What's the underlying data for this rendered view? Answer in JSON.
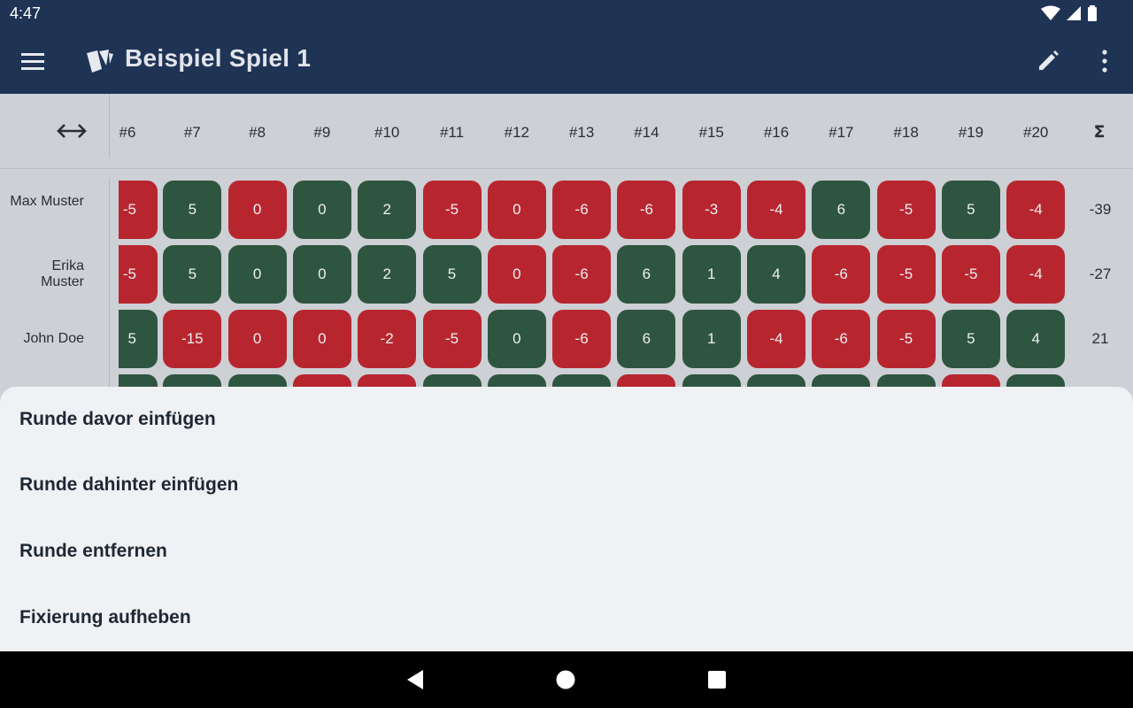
{
  "status_bar": {
    "time": "4:47"
  },
  "app_bar": {
    "title": "Beispiel Spiel 1"
  },
  "table": {
    "rounds": [
      "#6",
      "#7",
      "#8",
      "#9",
      "#10",
      "#11",
      "#12",
      "#13",
      "#14",
      "#15",
      "#16",
      "#17",
      "#18",
      "#19",
      "#20"
    ],
    "sum_label": "Σ",
    "players": [
      {
        "name": "Max Muster",
        "scores": [
          "-5",
          "5",
          "0",
          "0",
          "2",
          "-5",
          "0",
          "-6",
          "-6",
          "-3",
          "-4",
          "6",
          "-5",
          "5",
          "-4"
        ],
        "colors": [
          "red",
          "green",
          "red",
          "green",
          "green",
          "red",
          "red",
          "red",
          "red",
          "red",
          "red",
          "green",
          "red",
          "green",
          "red"
        ],
        "total": "-39"
      },
      {
        "name": "Erika Muster",
        "scores": [
          "-5",
          "5",
          "0",
          "0",
          "2",
          "5",
          "0",
          "-6",
          "6",
          "1",
          "4",
          "-6",
          "-5",
          "-5",
          "-4"
        ],
        "colors": [
          "red",
          "green",
          "green",
          "green",
          "green",
          "green",
          "red",
          "red",
          "green",
          "green",
          "green",
          "red",
          "red",
          "red",
          "red"
        ],
        "total": "-27"
      },
      {
        "name": "John Doe",
        "scores": [
          "5",
          "-15",
          "0",
          "0",
          "-2",
          "-5",
          "0",
          "-6",
          "6",
          "1",
          "-4",
          "-6",
          "-5",
          "5",
          "4"
        ],
        "colors": [
          "green",
          "red",
          "red",
          "red",
          "red",
          "red",
          "green",
          "red",
          "green",
          "green",
          "red",
          "red",
          "red",
          "green",
          "green"
        ],
        "total": "21"
      },
      {
        "name": "",
        "scores": [
          "",
          "",
          "",
          "",
          "",
          "",
          "",
          "",
          "",
          "",
          "",
          "",
          "",
          "",
          ""
        ],
        "colors": [
          "green",
          "green",
          "green",
          "red",
          "red",
          "green",
          "green",
          "green",
          "red",
          "green",
          "green",
          "green",
          "green",
          "red",
          "green"
        ],
        "total": ""
      }
    ]
  },
  "bottom_sheet": {
    "items": [
      {
        "label": "Runde davor einfügen"
      },
      {
        "label": "Runde dahinter einfügen"
      },
      {
        "label": "Runde entfernen"
      },
      {
        "label": "Fixierung aufheben"
      }
    ]
  },
  "colors": {
    "appbar": "#1f3355",
    "negative": "#b7262f",
    "positive": "#2e5540"
  },
  "icons": {
    "menu": "hamburger-icon",
    "logo": "cards-icon",
    "edit": "pencil-icon",
    "more": "more-vert-icon",
    "swap": "swap-horizontal-icon",
    "back": "back-triangle-icon",
    "home": "home-circle-icon",
    "recents": "recents-square-icon"
  }
}
